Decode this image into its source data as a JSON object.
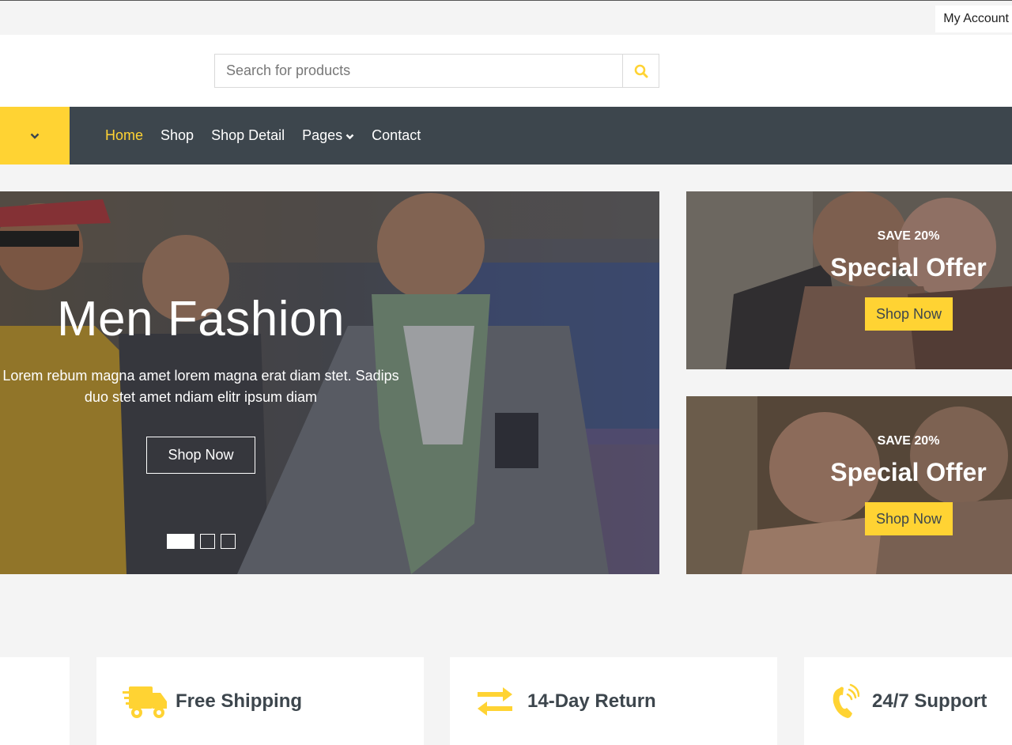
{
  "topbar": {
    "account_label": "My Account"
  },
  "search": {
    "placeholder": "Search for products"
  },
  "nav": {
    "links": [
      {
        "label": "Home",
        "active": true
      },
      {
        "label": "Shop",
        "active": false
      },
      {
        "label": "Shop Detail",
        "active": false
      },
      {
        "label": "Pages",
        "active": false
      },
      {
        "label": "Contact",
        "active": false
      }
    ]
  },
  "hero": {
    "title": "Men Fashion",
    "text": "Lorem rebum magna amet lorem magna erat diam stet. Sadips duo stet amet ndiam elitr ipsum diam",
    "button_label": "Shop Now",
    "slides": 3,
    "active_slide": 1
  },
  "offers": [
    {
      "save": "SAVE 20%",
      "title": "Special Offer",
      "button_label": "Shop Now"
    },
    {
      "save": "SAVE 20%",
      "title": "Special Offer",
      "button_label": "Shop Now"
    }
  ],
  "features": [
    {
      "icon": "truck-icon",
      "label": "Free Shipping"
    },
    {
      "icon": "exchange-icon",
      "label": "14-Day Return"
    },
    {
      "icon": "phone-icon",
      "label": "24/7 Support"
    }
  ],
  "colors": {
    "accent": "#ffd333",
    "dark": "#3d464d",
    "background": "#f4f4f4"
  }
}
